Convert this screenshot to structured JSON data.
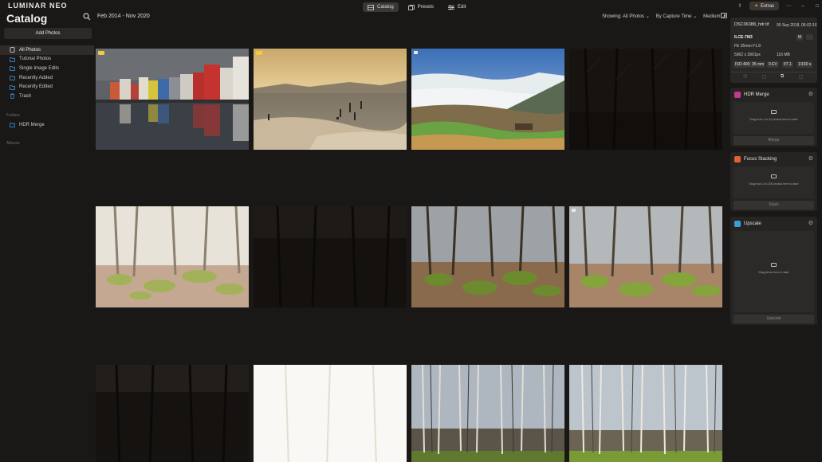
{
  "app": {
    "logo": "LUMINAR NEO",
    "title": "Catalog"
  },
  "header": {
    "date_range": "Feb 2014 - Nov 2020",
    "tabs": [
      {
        "label": "Catalog"
      },
      {
        "label": "Presets"
      },
      {
        "label": "Edit"
      }
    ],
    "showing": "Showing: All Photos ⌄",
    "sort": "By Capture Time ⌄",
    "size": "Medium ⌄",
    "extras_label": "Extras"
  },
  "sidebar": {
    "add_photos": "Add Photos",
    "items": [
      {
        "label": "All Photos",
        "icon": "all-photos-icon"
      },
      {
        "label": "Tutorial Photos",
        "icon": "folder-icon"
      },
      {
        "label": "Single Image Edits",
        "icon": "folder-icon"
      },
      {
        "label": "Recently Added",
        "icon": "folder-icon"
      },
      {
        "label": "Recently Edited",
        "icon": "folder-icon"
      },
      {
        "label": "Trash",
        "icon": "trash-icon"
      }
    ],
    "folders_label": "Folders",
    "folders": [
      {
        "label": "HDR Merge"
      }
    ],
    "albums_label": "Albums"
  },
  "info": {
    "filename": "DSC06388_hdr.tif",
    "date": "05 Sep 2018, 06:02:16",
    "camera": "ILCE-7M3",
    "mode": "M",
    "lens": "FE 35mm F1.8",
    "dimensions": "5962 x 3901px",
    "filesize": "116 MB",
    "iso": "ISO 400",
    "focal": "35 mm",
    "ev": "0 EV",
    "aperture": "f/7.1",
    "shutter": "1/160 s"
  },
  "tools": [
    {
      "name": "HDR Merge",
      "hint": "Drag from 1 to 10 photos here to start",
      "button": "Merge",
      "color": "#c23a8c"
    },
    {
      "name": "Focus Stacking",
      "hint": "Drag from 2 to 300 photos here to start",
      "button": "Stack",
      "color": "#e3612f"
    },
    {
      "name": "Upscale",
      "hint": "Drag photo here to start",
      "button": "Upscale",
      "color": "#3a9fd6"
    }
  ]
}
